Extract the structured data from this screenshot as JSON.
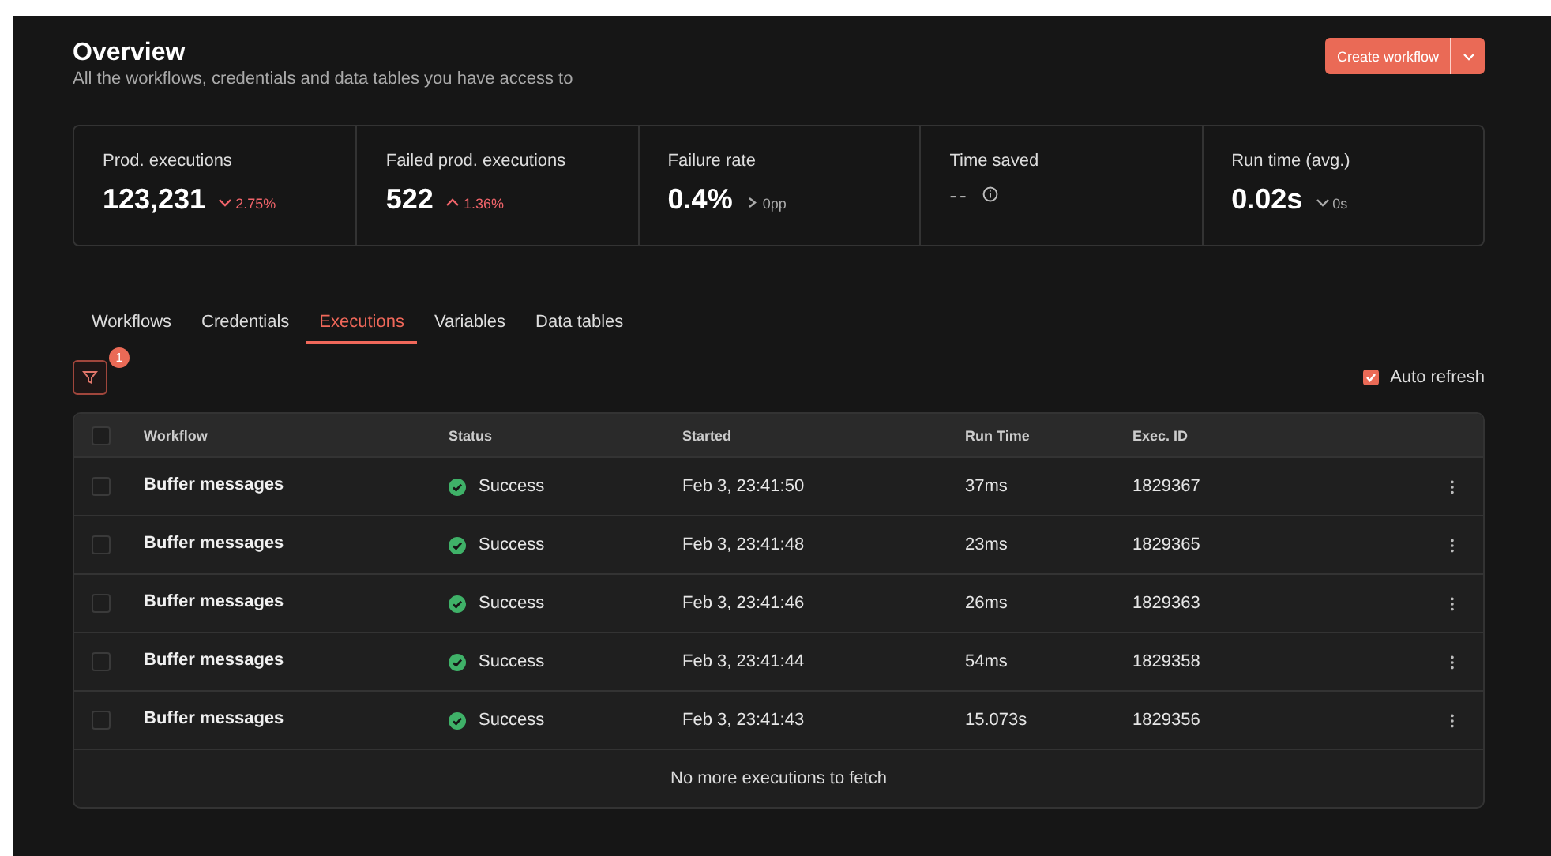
{
  "header": {
    "title": "Overview",
    "subtitle": "All the workflows, credentials and data tables you have access to",
    "create_button": "Create workflow"
  },
  "stats": [
    {
      "label": "Prod. executions",
      "value": "123,231",
      "delta": "2.75%",
      "kind": "down",
      "color": "#f0646a"
    },
    {
      "label": "Failed prod. executions",
      "value": "522",
      "delta": "1.36%",
      "kind": "up",
      "color": "#f0646a"
    },
    {
      "label": "Failure rate",
      "value": "0.4%",
      "delta": "0pp",
      "kind": "flat",
      "color": "#aaaaaa"
    },
    {
      "label": "Time saved",
      "value": "--",
      "kind": "info"
    },
    {
      "label": "Run time (avg.)",
      "value": "0.02s",
      "delta": "0s",
      "kind": "down",
      "color": "#aaaaaa"
    }
  ],
  "tabs": [
    {
      "label": "Workflows",
      "selected": false
    },
    {
      "label": "Credentials",
      "selected": false
    },
    {
      "label": "Executions",
      "selected": true
    },
    {
      "label": "Variables",
      "selected": false
    },
    {
      "label": "Data tables",
      "selected": false
    }
  ],
  "filter": {
    "badge": "1"
  },
  "auto_refresh": {
    "label": "Auto refresh",
    "checked": true
  },
  "table": {
    "select_all": false,
    "columns": [
      "Workflow",
      "Status",
      "Started",
      "Run Time",
      "Exec. ID"
    ],
    "rows": [
      {
        "checked": false,
        "workflow": "Buffer messages",
        "status": "Success",
        "kind": "success",
        "started": "Feb 3, 23:41:50",
        "run_time": "37ms",
        "exec_id": "1829367"
      },
      {
        "checked": false,
        "workflow": "Buffer messages",
        "status": "Success",
        "kind": "success",
        "started": "Feb 3, 23:41:48",
        "run_time": "23ms",
        "exec_id": "1829365"
      },
      {
        "checked": false,
        "workflow": "Buffer messages",
        "status": "Success",
        "kind": "success",
        "started": "Feb 3, 23:41:46",
        "run_time": "26ms",
        "exec_id": "1829363"
      },
      {
        "checked": false,
        "workflow": "Buffer messages",
        "status": "Success",
        "kind": "success",
        "started": "Feb 3, 23:41:44",
        "run_time": "54ms",
        "exec_id": "1829358"
      },
      {
        "checked": false,
        "workflow": "Buffer messages",
        "status": "Success",
        "kind": "success",
        "started": "Feb 3, 23:41:43",
        "run_time": "15.073s",
        "exec_id": "1829356"
      }
    ],
    "footer": "No more executions to fetch"
  }
}
